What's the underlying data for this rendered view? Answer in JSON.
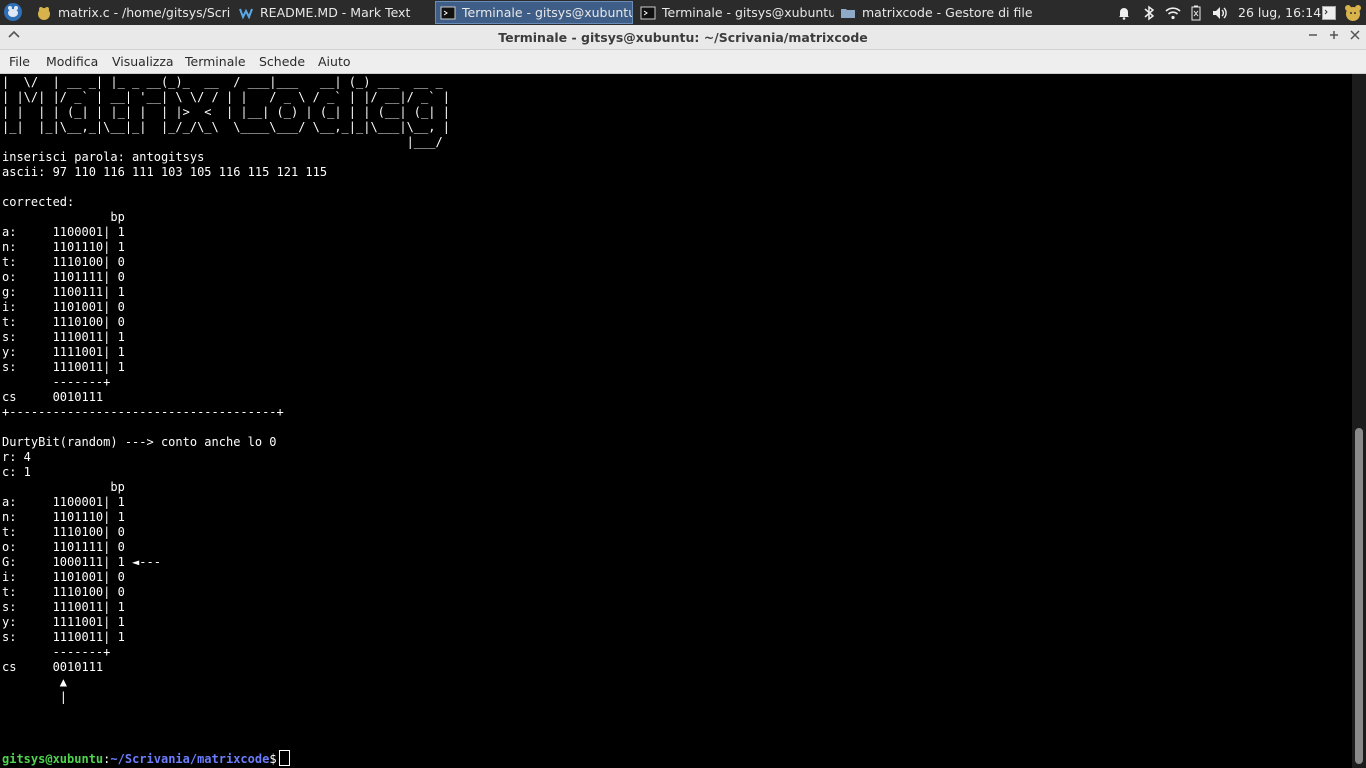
{
  "panel": {
    "tasks": [
      {
        "label": "matrix.c - /home/gitsys/Scriv...",
        "icon": "text-editor-icon"
      },
      {
        "label": "README.MD - Mark Text",
        "icon": "marktext-icon"
      },
      {
        "label": "Terminale - gitsys@xubuntu: ...",
        "icon": "terminal-icon"
      },
      {
        "label": "Terminale - gitsys@xubuntu: ...",
        "icon": "terminal-icon"
      },
      {
        "label": "matrixcode - Gestore di file",
        "icon": "folder-icon"
      }
    ],
    "clock": "26 lug, 16:14",
    "accent": "#3f5e87"
  },
  "window": {
    "title": "Terminale - gitsys@xubuntu: ~/Scrivania/matrixcode"
  },
  "menubar": [
    "File",
    "Modifica",
    "Visualizza",
    "Terminale",
    "Schede",
    "Aiuto"
  ],
  "terminal": {
    "output": "|  \\/  | __ _| |_ _ __(_)_  __  / ___|___   __| (_) ___  __ _\n| |\\/| |/ _` | __| '__| \\ \\/ / | |   / _ \\ / _` | |/ __|/ _` |\n| |  | | (_| | |_| |  | |>  <  | |__| (_) | (_| | | (__| (_| |\n|_|  |_|\\__,_|\\__|_|  |_/_/\\_\\  \\____\\___/ \\__,_|_|\\___|\\__, |\n                                                        |___/\ninserisci parola: antogitsys\nascii: 97 110 116 111 103 105 116 115 121 115\n\ncorrected:\n               bp\na:     1100001| 1\nn:     1101110| 1\nt:     1110100| 0\no:     1101111| 0\ng:     1100111| 1\ni:     1101001| 0\nt:     1110100| 0\ns:     1110011| 1\ny:     1111001| 1\ns:     1110011| 1\n       -------+\ncs     0010111\n+-------------------------------------+\n\nDurtyBit(random) ---> conto anche lo 0\nr: 4\nc: 1\n               bp\na:     1100001| 1\nn:     1101110| 1\nt:     1110100| 0\no:     1101111| 0\nG:     1000111| 1 ◄---\ni:     1101001| 0\nt:     1110100| 0\ns:     1110011| 1\ny:     1111001| 1\ns:     1110011| 1\n       -------+\ncs     0010111\n        ▲\n        |",
    "prompt_user": "gitsys@xubuntu",
    "prompt_sep": ":",
    "prompt_path": "~/Scrivania/matrixcode",
    "prompt_symbol": "$",
    "user_color": "#4ed44e",
    "path_color": "#6b7dfc"
  }
}
